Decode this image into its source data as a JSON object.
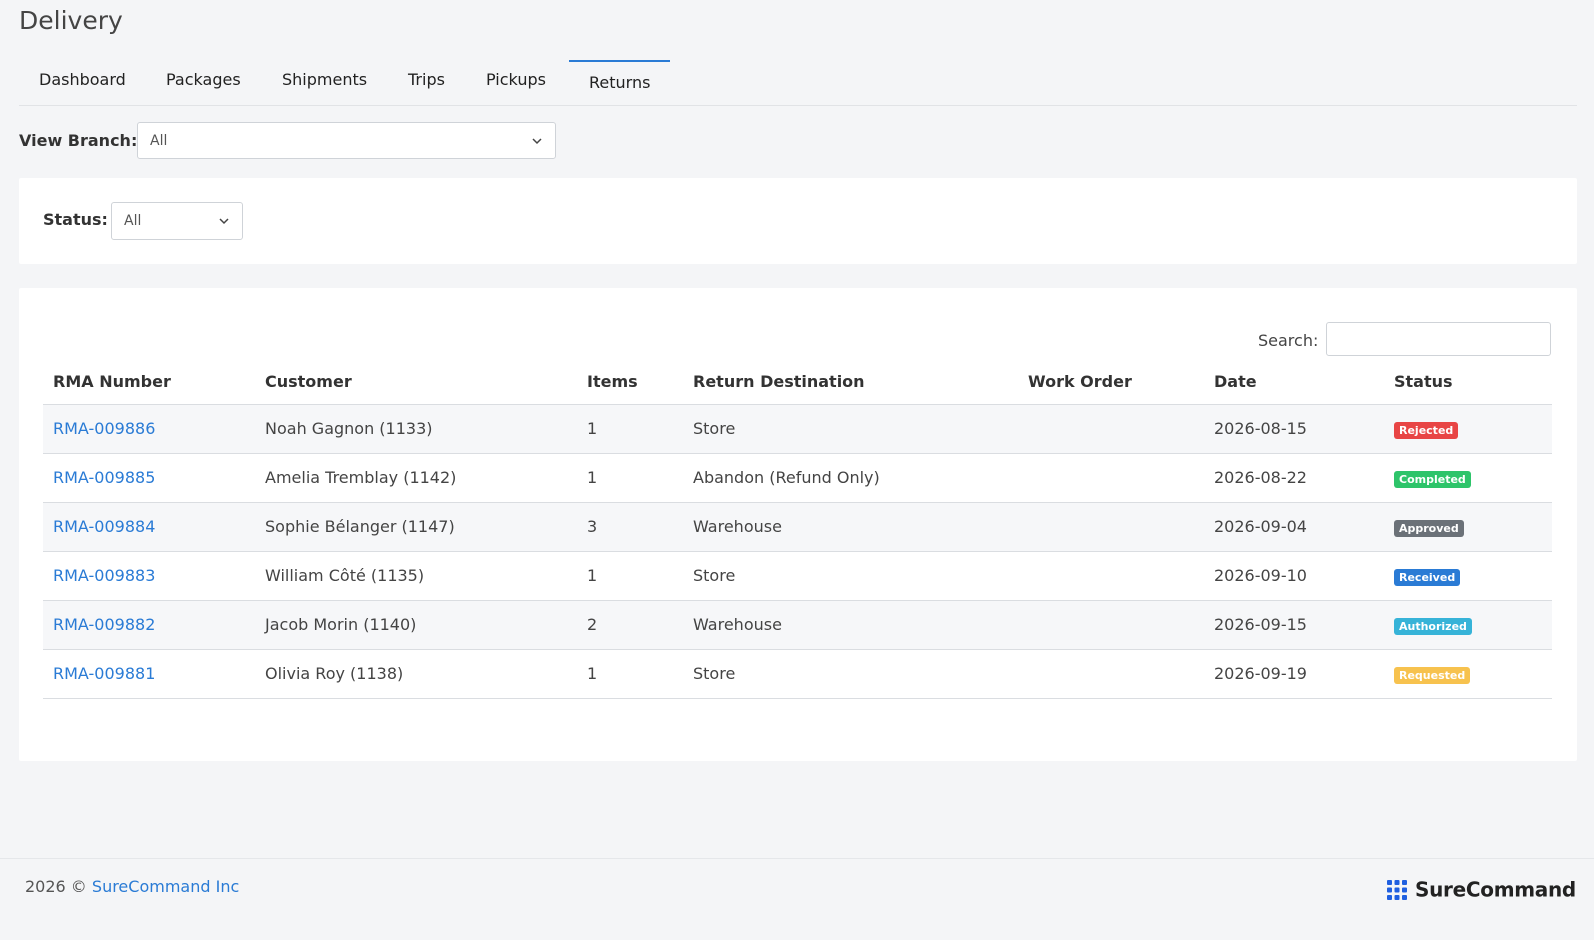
{
  "page": {
    "title": "Delivery"
  },
  "tabs": [
    {
      "label": "Dashboard",
      "active": false
    },
    {
      "label": "Packages",
      "active": false
    },
    {
      "label": "Shipments",
      "active": false
    },
    {
      "label": "Trips",
      "active": false
    },
    {
      "label": "Pickups",
      "active": false
    },
    {
      "label": "Returns",
      "active": true
    }
  ],
  "branch": {
    "label": "View Branch:",
    "value": "All"
  },
  "filter": {
    "label": "Status:",
    "value": "All"
  },
  "search": {
    "label": "Search:",
    "value": ""
  },
  "table": {
    "headers": [
      "RMA Number",
      "Customer",
      "Items",
      "Return Destination",
      "Work Order",
      "Date",
      "Status"
    ],
    "rows": [
      {
        "rma": "RMA-009886",
        "customer": "Noah Gagnon (1133)",
        "items": "1",
        "destination": "Store",
        "work_order": "",
        "date": "2026-08-15",
        "status": "Rejected",
        "status_color": "#e84545"
      },
      {
        "rma": "RMA-009885",
        "customer": "Amelia Tremblay (1142)",
        "items": "1",
        "destination": "Abandon (Refund Only)",
        "work_order": "",
        "date": "2026-08-22",
        "status": "Completed",
        "status_color": "#2ec46a"
      },
      {
        "rma": "RMA-009884",
        "customer": "Sophie Bélanger (1147)",
        "items": "3",
        "destination": "Warehouse",
        "work_order": "",
        "date": "2026-09-04",
        "status": "Approved",
        "status_color": "#6b7178"
      },
      {
        "rma": "RMA-009883",
        "customer": "William Côté (1135)",
        "items": "1",
        "destination": "Store",
        "work_order": "",
        "date": "2026-09-10",
        "status": "Received",
        "status_color": "#2a7bd5"
      },
      {
        "rma": "RMA-009882",
        "customer": "Jacob Morin (1140)",
        "items": "2",
        "destination": "Warehouse",
        "work_order": "",
        "date": "2026-09-15",
        "status": "Authorized",
        "status_color": "#36b3d8"
      },
      {
        "rma": "RMA-009881",
        "customer": "Olivia Roy (1138)",
        "items": "1",
        "destination": "Store",
        "work_order": "",
        "date": "2026-09-19",
        "status": "Requested",
        "status_color": "#f7c24e"
      }
    ]
  },
  "footer": {
    "copyright": "2026 ©",
    "company_link": "SureCommand Inc",
    "brand": "SureCommand"
  },
  "colors": {
    "accent": "#2a7bd5",
    "brand": "#1f5fe0"
  }
}
